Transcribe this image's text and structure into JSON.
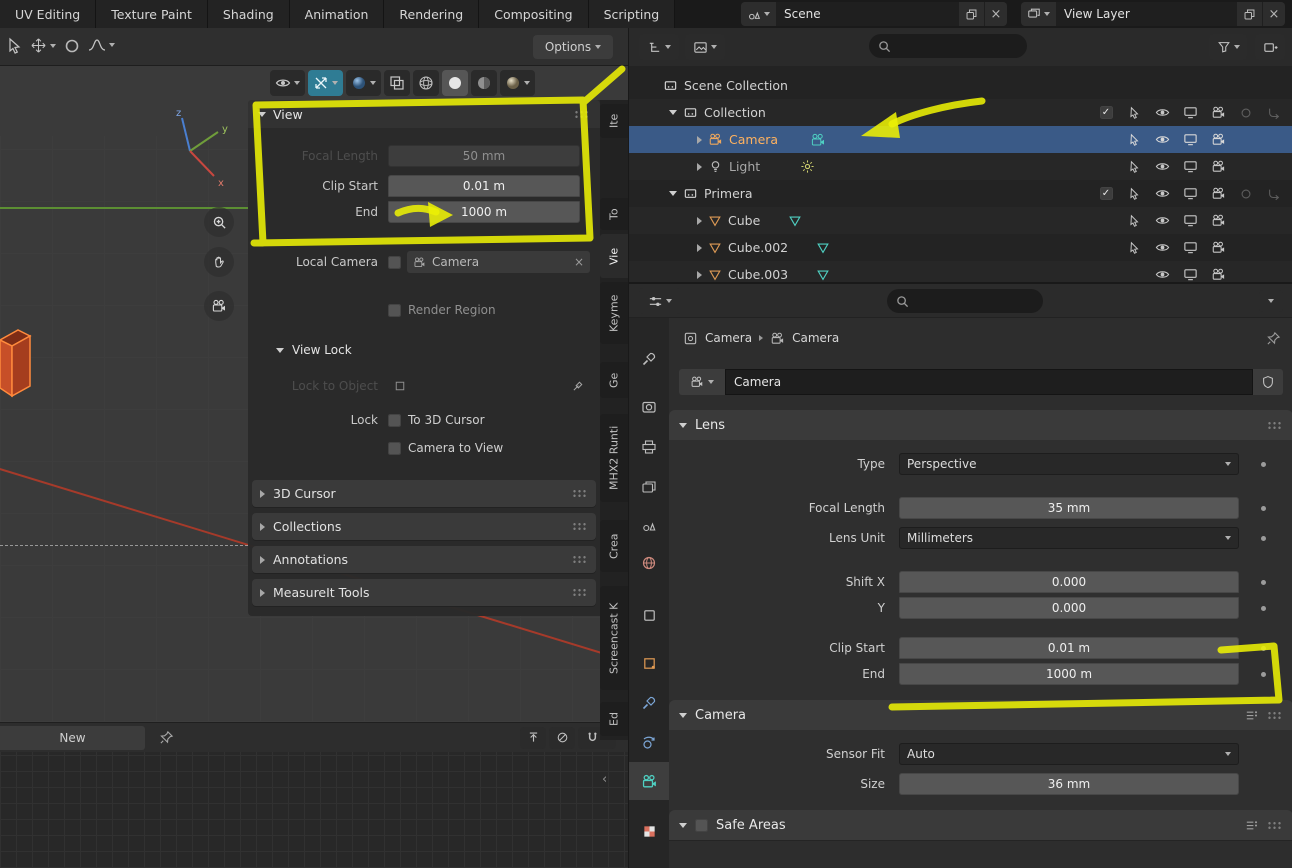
{
  "topbar": {
    "workspaces": [
      "UV Editing",
      "Texture Paint",
      "Shading",
      "Animation",
      "Rendering",
      "Compositing",
      "Scripting"
    ],
    "scene_selector": {
      "value": "Scene"
    },
    "view_layer_selector": {
      "value": "View Layer"
    }
  },
  "tool_header": {
    "options_button": "Options"
  },
  "viewport": {
    "axis_labels": {
      "x": "x",
      "y": "y",
      "z": "z"
    },
    "sidebar_tabs": [
      "Ite",
      "To",
      "Vie",
      "Keyme",
      "Ge",
      "MHX2 Runti",
      "Crea",
      "Screencast K",
      "Ed"
    ],
    "footer": {
      "new_button": "New"
    }
  },
  "n_panel": {
    "view": {
      "title": "View",
      "focal_length_label": "Focal Length",
      "focal_length_value": "50 mm",
      "clip_start_label": "Clip Start",
      "clip_start_value": "0.01 m",
      "clip_end_label": "End",
      "clip_end_value": "1000 m",
      "local_camera_label": "Local Camera",
      "local_camera_value": "Camera",
      "render_region_label": "Render Region",
      "view_lock_title": "View Lock",
      "lock_to_object_label": "Lock to Object",
      "lock_label": "Lock",
      "to_3d_cursor_label": "To 3D Cursor",
      "camera_to_view_label": "Camera to View"
    },
    "collapsed_panels": [
      "3D Cursor",
      "Collections",
      "Annotations",
      "MeasureIt Tools"
    ]
  },
  "outliner": {
    "rows": [
      {
        "label": "Scene Collection"
      },
      {
        "label": "Collection"
      },
      {
        "label": "Camera"
      },
      {
        "label": "Light"
      },
      {
        "label": "Primera"
      },
      {
        "label": "Cube"
      },
      {
        "label": "Cube.002"
      },
      {
        "label": "Cube.003"
      }
    ]
  },
  "properties": {
    "breadcrumb": {
      "object": "Camera",
      "data": "Camera"
    },
    "name_field": "Camera",
    "lens_panel": {
      "title": "Lens",
      "type_label": "Type",
      "type_value": "Perspective",
      "focal_length_label": "Focal Length",
      "focal_length_value": "35 mm",
      "lens_unit_label": "Lens Unit",
      "lens_unit_value": "Millimeters",
      "shift_x_label": "Shift X",
      "shift_x_value": "0.000",
      "shift_y_label": "Y",
      "shift_y_value": "0.000",
      "clip_start_label": "Clip Start",
      "clip_start_value": "0.01 m",
      "clip_end_label": "End",
      "clip_end_value": "1000 m"
    },
    "camera_panel": {
      "title": "Camera",
      "sensor_fit_label": "Sensor Fit",
      "sensor_fit_value": "Auto",
      "size_label": "Size",
      "size_value": "36 mm"
    },
    "safe_areas_panel": {
      "title": "Safe Areas"
    }
  },
  "colors": {
    "annotation_yellow": "#ecf005",
    "selection_blue": "#3a5a87",
    "active_object_orange": "#ffb25f",
    "data_teal": "#4fd0c2"
  }
}
